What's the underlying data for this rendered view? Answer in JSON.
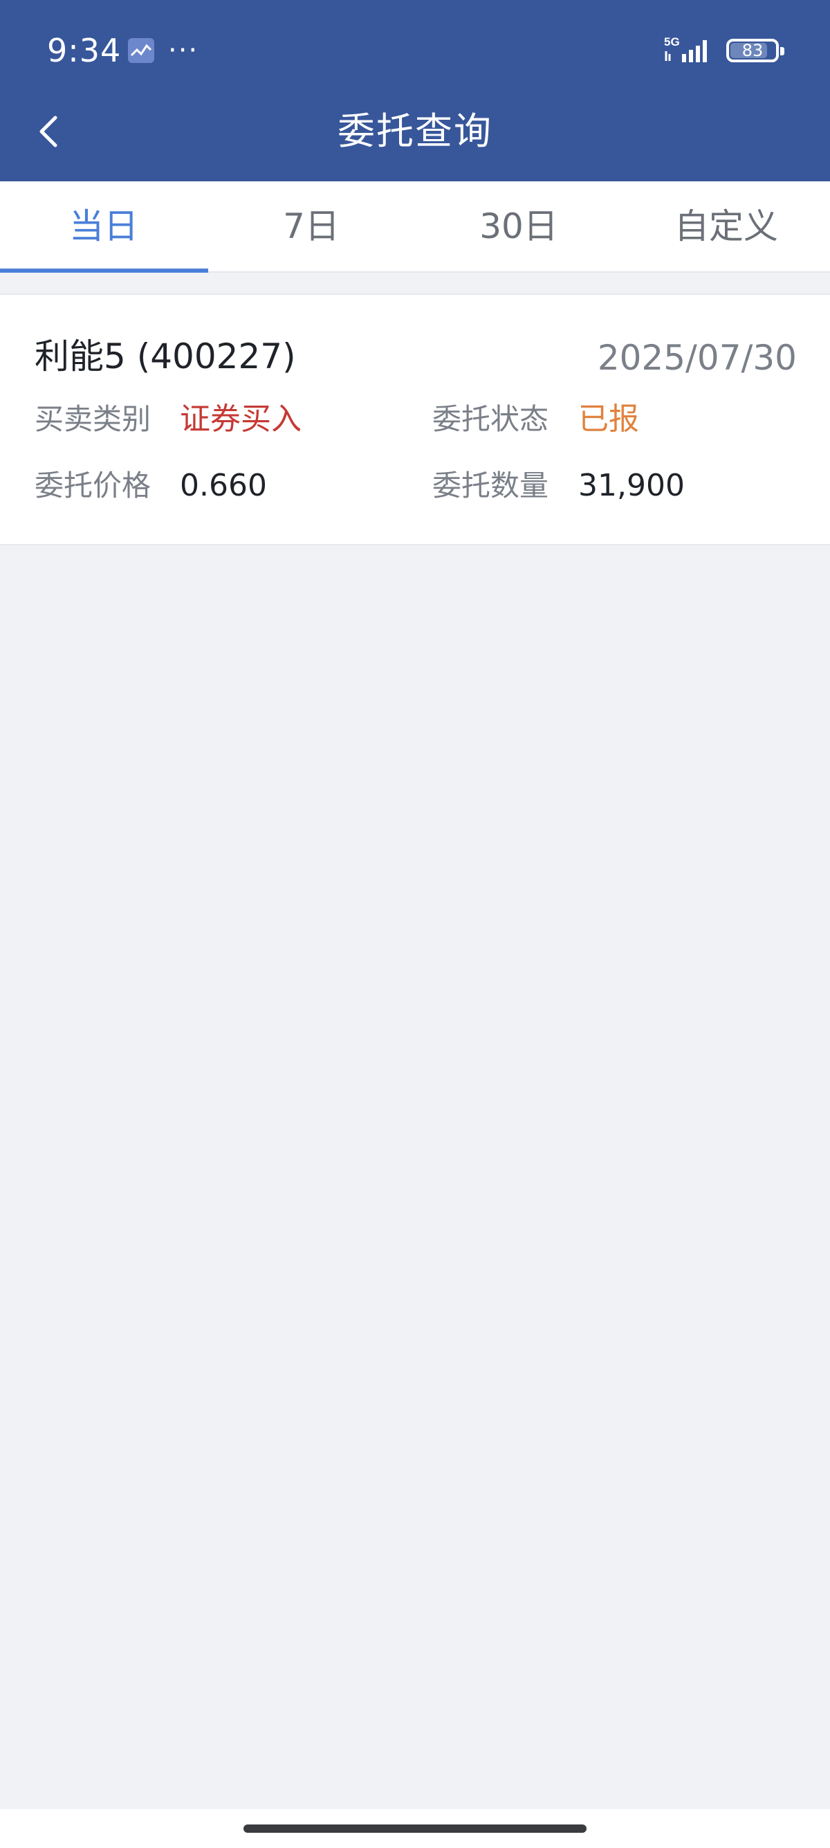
{
  "status_bar": {
    "time": "9:34",
    "more": "···",
    "network": "5G",
    "battery": "83",
    "battery_level": 0.83
  },
  "header": {
    "title": "委托查询"
  },
  "tabs": [
    {
      "label": "当日",
      "active": true
    },
    {
      "label": "7日",
      "active": false
    },
    {
      "label": "30日",
      "active": false
    },
    {
      "label": "自定义",
      "active": false
    }
  ],
  "orders": [
    {
      "stock": "利能5 (400227)",
      "date": "2025/07/30",
      "side_label": "买卖类别",
      "side_value": "证券买入",
      "status_label": "委托状态",
      "status_value": "已报",
      "price_label": "委托价格",
      "price_value": "0.660",
      "qty_label": "委托数量",
      "qty_value": "31,900"
    }
  ],
  "colors": {
    "header_bg": "#38579a",
    "accent": "#4a7fd8",
    "buy": "#c53a34",
    "status": "#e0823e",
    "page_bg": "#f0f2f6"
  }
}
